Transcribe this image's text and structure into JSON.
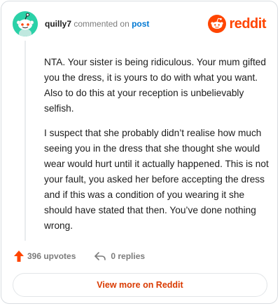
{
  "header": {
    "username": "quilly7",
    "verb": "commented on",
    "post_link": "post",
    "brand": "reddit"
  },
  "comment": {
    "paragraphs": [
      "NTA. Your sister is being ridiculous. Your mum gifted you the dress, it is yours to do with what you want. Also to do this at your reception is unbelievably selfish.",
      "I suspect that she probably didn’t realise how much seeing you in the dress that she thought she would wear would hurt until it actually happened. This is not your fault, you asked her before accepting the dress and if this was a condition of you wearing it she should have stated that then. You’ve done nothing wrong."
    ]
  },
  "actions": {
    "upvotes": "396 upvotes",
    "replies": "0 replies"
  },
  "footer": {
    "view_more": "View more on Reddit"
  },
  "colors": {
    "accent": "#ff4500",
    "link": "#0079d3",
    "avatar_bg": "#2bd1a8",
    "button_text": "#d93a00"
  },
  "icons": {
    "avatar": "snoo-avatar-icon",
    "brand": "reddit-logo-icon",
    "upvote": "upvote-arrow-icon",
    "reply": "reply-arrow-icon"
  }
}
